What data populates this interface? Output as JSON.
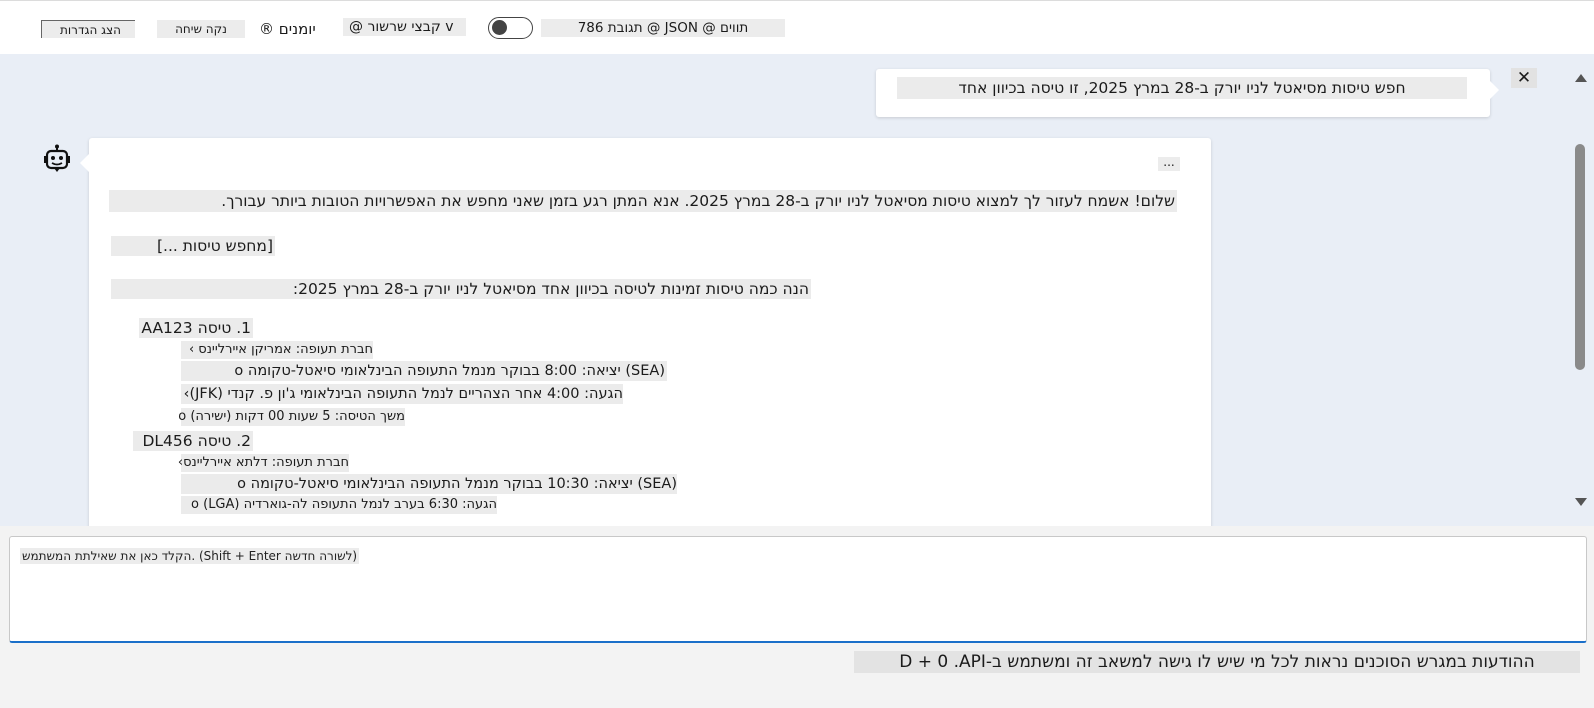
{
  "toolbar": {
    "show_settings": "הצג הגדרות",
    "clear_chat": "נקה שיחה",
    "logs": "® יומנים",
    "files_dropdown": "@ קבצי שרשור v",
    "tokens": "תגובת 786 @ JSON @ תווים"
  },
  "chat": {
    "user_message": "חפש טיסות מסיאטל לניו יורק ב-28 במרץ 2025, זו טיסה בכיוון אחד",
    "close_label": "✕",
    "more_label": "...",
    "greeting": "שלום! אשמח לעזור לך למצוא טיסות מסיאטל לניו יורק ב-28 במרץ 2025. אנא המתן רגע בזמן שאני מחפש את האפשרויות הטובות ביותר עבורך.",
    "searching": "[מחפש טיסות ...]",
    "intro": "הנה כמה טיסות זמינות לטיסה בכיוון אחד מסיאטל לניו יורק ב-28 במרץ 2025:",
    "flights": [
      {
        "title": "1. טיסה AA123",
        "airline": "חברת תעופה: אמריקן איירליינס ›",
        "departure": "(SEA) יציאה: 8:00 בבוקר מנמל התעופה הבינלאומי סיאטל-טקומה o",
        "arrival": "הגעה: 4:00 אחר הצהריים לנמל התעופה הבינלאומי ג'ון פ. קנדי (JFK)›",
        "duration": "משך הטיסה: 5 שעות 00 דקות (ישירה) o"
      },
      {
        "title": "2. טיסה DL456",
        "airline": "חברת תעופה: דלתא איירליינס›",
        "departure": "(SEA) יציאה: 10:30 בבוקר מנמל התעופה הבינלאומי סיאטל-טקומה o",
        "arrival": "הגעה: 6:30 בערב לנמל התעופה לה-גוארדיה (LGA) o"
      }
    ]
  },
  "input": {
    "placeholder": "הקלד כאן את שאילתת המשתמש. (Shift + Enter לשורה חדשה)"
  },
  "footer": {
    "disclaimer": "ההודעות במגרש הסוכנים נראות לכל מי שיש לו גישה למשאב זה ומשתמש ב-D + 0 .API"
  },
  "colors": {
    "accent": "#1a6fc9",
    "chat_background": "#e9eef6",
    "highlight": "#ebebeb"
  },
  "icons": {
    "bot": "robot-icon",
    "close": "close-icon",
    "scroll_up": "chevron-up-icon",
    "scroll_down": "chevron-down-icon"
  }
}
